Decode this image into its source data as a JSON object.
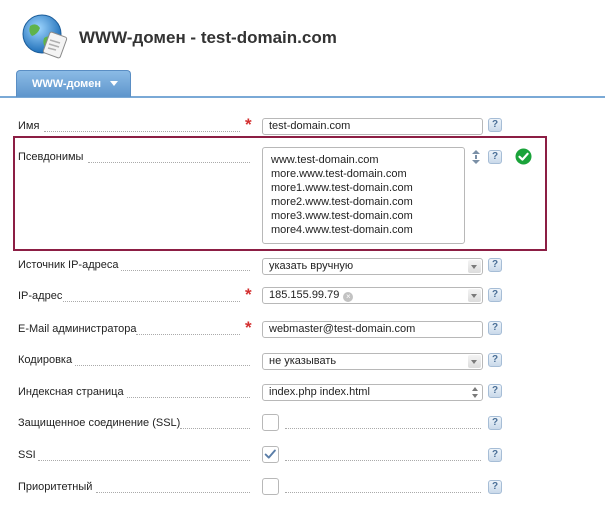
{
  "header": {
    "title": "WWW-домен - test-domain.com",
    "icon": "globe-document-icon"
  },
  "tabs": [
    {
      "label": "WWW-домен",
      "active": true
    }
  ],
  "form": {
    "name": {
      "label": "Имя",
      "required": true,
      "value": "test-domain.com"
    },
    "aliases": {
      "label": "Псевдонимы",
      "lines": [
        "www.test-domain.com",
        "more.www.test-domain.com",
        "more1.www.test-domain.com",
        "more2.www.test-domain.com",
        "more3.www.test-domain.com",
        "more4.www.test-domain.com"
      ],
      "status": "valid"
    },
    "ip_source": {
      "label": "Источник IP-адреса",
      "value": "указать вручную"
    },
    "ip": {
      "label": "IP-адрес",
      "required": true,
      "value": "185.155.99.79"
    },
    "admin_email": {
      "label": "E-Mail администратора",
      "required": true,
      "value": "webmaster@test-domain.com"
    },
    "encoding": {
      "label": "Кодировка",
      "value": "не указывать"
    },
    "index_page": {
      "label": "Индексная страница",
      "value": "index.php index.html"
    },
    "ssl": {
      "label": "Защищенное соединение (SSL)",
      "checked": false
    },
    "ssi": {
      "label": "SSI",
      "checked": true
    },
    "priority": {
      "label": "Приоритетный",
      "checked": false
    }
  },
  "help_label": "?",
  "required_mark": "*",
  "colors": {
    "tab": "#5e95cc",
    "required": "#d32f2f",
    "highlight_frame": "#8c1e44",
    "ok": "#1aa33a"
  }
}
